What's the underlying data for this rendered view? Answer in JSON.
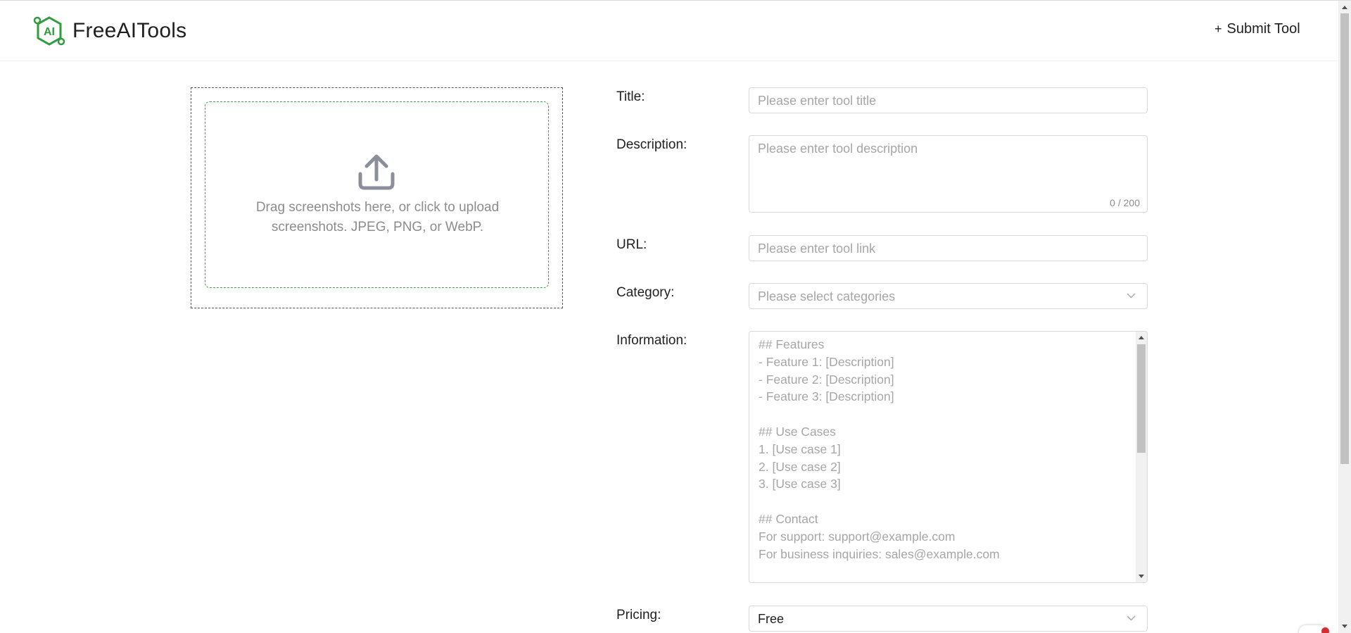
{
  "brand": {
    "name": "FreeAITools",
    "logo_text": "AI",
    "color": "#2e9d3f"
  },
  "header": {
    "submit_plus": "+",
    "submit_label": "Submit Tool"
  },
  "upload": {
    "line1": "Drag screenshots here, or click to upload",
    "line2": "screenshots. JPEG, PNG, or WebP."
  },
  "form": {
    "title": {
      "label": "Title:",
      "placeholder": "Please enter tool title"
    },
    "description": {
      "label": "Description:",
      "placeholder": "Please enter tool description",
      "counter": "0 / 200"
    },
    "url": {
      "label": "URL:",
      "placeholder": "Please enter tool link"
    },
    "category": {
      "label": "Category:",
      "placeholder": "Please select categories"
    },
    "information": {
      "label": "Information:",
      "placeholder": "## Features\n- Feature 1: [Description]\n- Feature 2: [Description]\n- Feature 3: [Description]\n\n## Use Cases\n1. [Use case 1]\n2. [Use case 2]\n3. [Use case 3]\n\n## Contact\nFor support: support@example.com\nFor business inquiries: sales@example.com\n\n## Why Choose Us?"
    },
    "pricing": {
      "label": "Pricing:",
      "value": "Free"
    }
  },
  "icons": {
    "logo": "hexagon-ai-logo-icon",
    "upload": "upload-icon",
    "chevron": "chevron-down-icon"
  }
}
